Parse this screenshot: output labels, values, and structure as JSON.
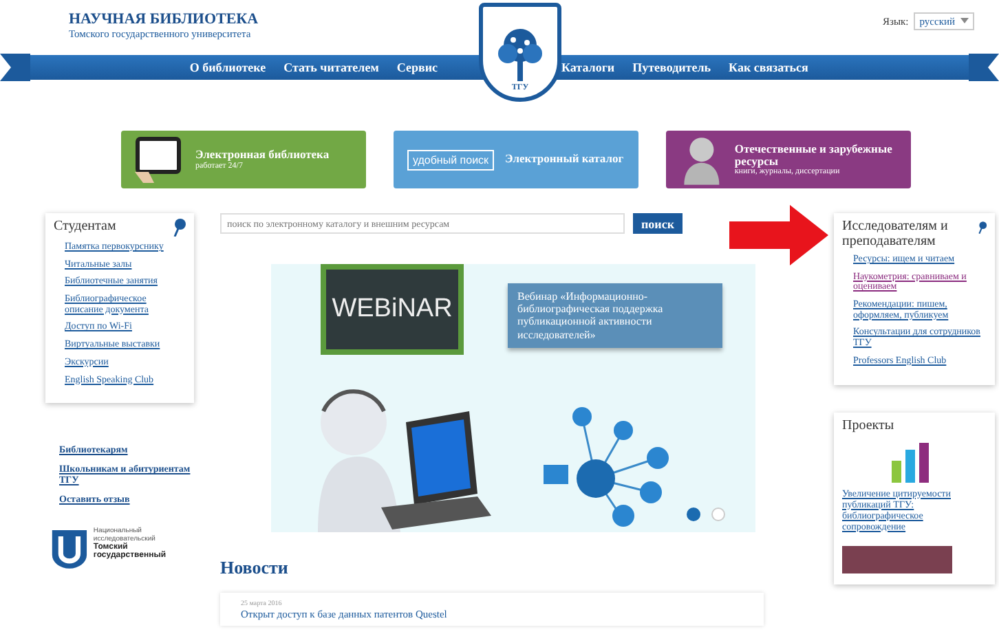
{
  "header": {
    "title": "НАУЧНАЯ БИБЛИОТЕКА",
    "subtitle": "Томского государственного университета",
    "logo_text": "ТГУ",
    "language_label": "Язык:",
    "language_value": "русский"
  },
  "nav": {
    "left": [
      "О библиотеке",
      "Стать читателем",
      "Сервис"
    ],
    "right": [
      "Каталоги",
      "Путеводитель",
      "Как связаться"
    ]
  },
  "banners": [
    {
      "kind": "tablet",
      "title": "Электронная библиотека",
      "note": "работает 24/7"
    },
    {
      "kind": "search",
      "tag": "удобный поиск",
      "title": "Электронный каталог"
    },
    {
      "kind": "bust",
      "title": "Отечественные и зарубежные ресурсы",
      "note": "книги, журналы, диссертации"
    }
  ],
  "students": {
    "title": "Студентам",
    "items": [
      "Памятка первокурснику",
      "Читальные залы",
      "Библиотечные занятия",
      "Библиографическое описание документа",
      "Доступ по Wi-Fi",
      "Виртуальные выставки",
      "Экскурсии",
      "English Speaking Club"
    ]
  },
  "left_links": [
    "Библиотекарям",
    "Школьникам и абитуриентам ТГУ",
    "Оставить отзыв"
  ],
  "university_logo": {
    "lines": [
      "Национальный исследовательский",
      "Томский государственный"
    ]
  },
  "search": {
    "placeholder": "поиск по электронному каталогу и внешним ресурсам",
    "button": "поиск"
  },
  "slider": {
    "board_text": "WEBiNAR",
    "caption": "Вебинар «Информационно-библиографическая поддержка публикационной активности исследователей»",
    "dots": [
      {
        "selected": true
      },
      {
        "selected": false
      }
    ]
  },
  "news": {
    "title": "Новости",
    "items": [
      {
        "date": "25 марта 2016",
        "headline": "Открыт доступ к базе данных патентов Questel"
      }
    ]
  },
  "researchers": {
    "title": "Исследователям и преподавателям",
    "items": [
      {
        "label": "Ресурсы: ищем и читаем",
        "visited": false
      },
      {
        "label": "Наукометрия: сравниваем и оцениваем",
        "visited": true
      },
      {
        "label": "Рекомендации: пишем, оформляем, публикуем",
        "visited": false
      },
      {
        "label": "Консультации для сотрудников ТГУ",
        "visited": false
      },
      {
        "label": "Professors English Club",
        "visited": false
      }
    ]
  },
  "projects": {
    "title": "Проекты",
    "link": "Увеличение цитируемости публикаций ТГУ: библиографическое сопровождение"
  }
}
